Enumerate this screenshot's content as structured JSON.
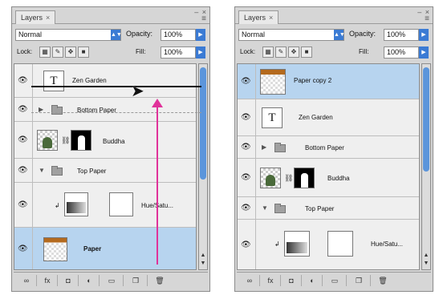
{
  "left": {
    "tab_label": "Layers",
    "tab_close": "×",
    "window_buttons": "– ×",
    "menu_icon": "≡",
    "blend_mode": "Normal",
    "opacity_label": "Opacity:",
    "opacity_value": "100%",
    "lock_label": "Lock:",
    "fill_label": "Fill:",
    "fill_value": "100%",
    "layers": [
      {
        "name": "Zen Garden"
      },
      {
        "name": "Bottom Paper"
      },
      {
        "name": "Buddha"
      },
      {
        "name": "Top Paper"
      },
      {
        "name": "Hue/Satu..."
      },
      {
        "name": "Paper"
      }
    ]
  },
  "right": {
    "tab_label": "Layers",
    "tab_close": "×",
    "window_buttons": "– ×",
    "menu_icon": "≡",
    "blend_mode": "Normal",
    "opacity_label": "Opacity:",
    "opacity_value": "100%",
    "lock_label": "Lock:",
    "fill_label": "Fill:",
    "fill_value": "100%",
    "layers": [
      {
        "name": "Paper copy 2"
      },
      {
        "name": "Zen Garden"
      },
      {
        "name": "Bottom Paper"
      },
      {
        "name": "Buddha"
      },
      {
        "name": "Top Paper"
      },
      {
        "name": "Hue/Satu..."
      }
    ]
  },
  "icons": {
    "eye": "👁",
    "expanded": "▼",
    "collapsed": "▶",
    "chain": "⛓",
    "scroll_up": "▲",
    "scroll_down": "▼",
    "link_layers": "∞",
    "fx": "fx",
    "mask": "◘",
    "adjustment": "◐",
    "group": "▭",
    "new_layer": "❐",
    "trash": "🗑",
    "cursor": "➤"
  },
  "colors": {
    "selection": "#b7d4ef",
    "arrow": "#e0329a",
    "control_blue": "#3b7bd4"
  }
}
